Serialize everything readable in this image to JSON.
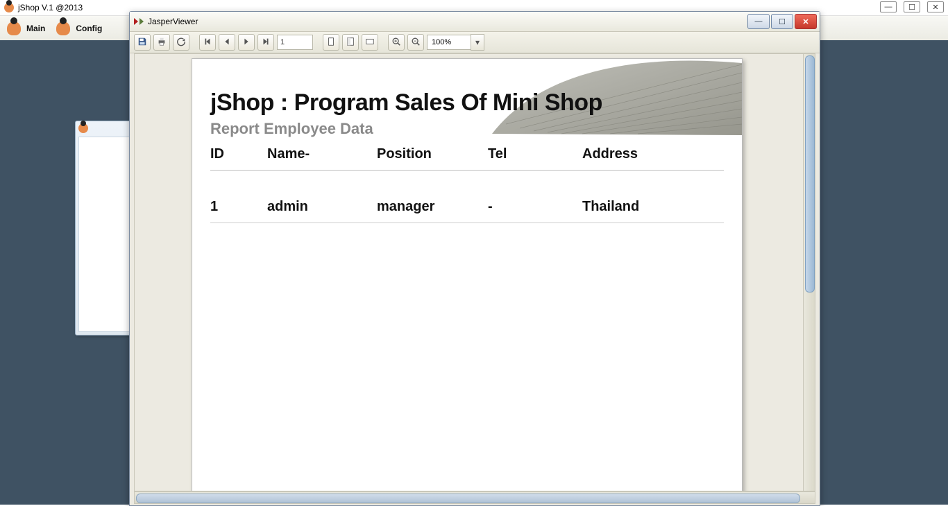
{
  "app": {
    "title": "jShop V.1 @2013",
    "menu": {
      "main": "Main",
      "config": "Config"
    }
  },
  "viewer": {
    "title": "JasperViewer",
    "page_number": "1",
    "zoom": "100%"
  },
  "report": {
    "title": "jShop : Program Sales Of Mini Shop",
    "subtitle": "Report Employee Data",
    "columns": {
      "id": "ID",
      "name": "Name-",
      "position": "Position",
      "tel": "Tel",
      "address": "Address"
    },
    "rows": [
      {
        "id": "1",
        "name": "admin",
        "position": "manager",
        "tel": "-",
        "address": "Thailand"
      }
    ]
  }
}
